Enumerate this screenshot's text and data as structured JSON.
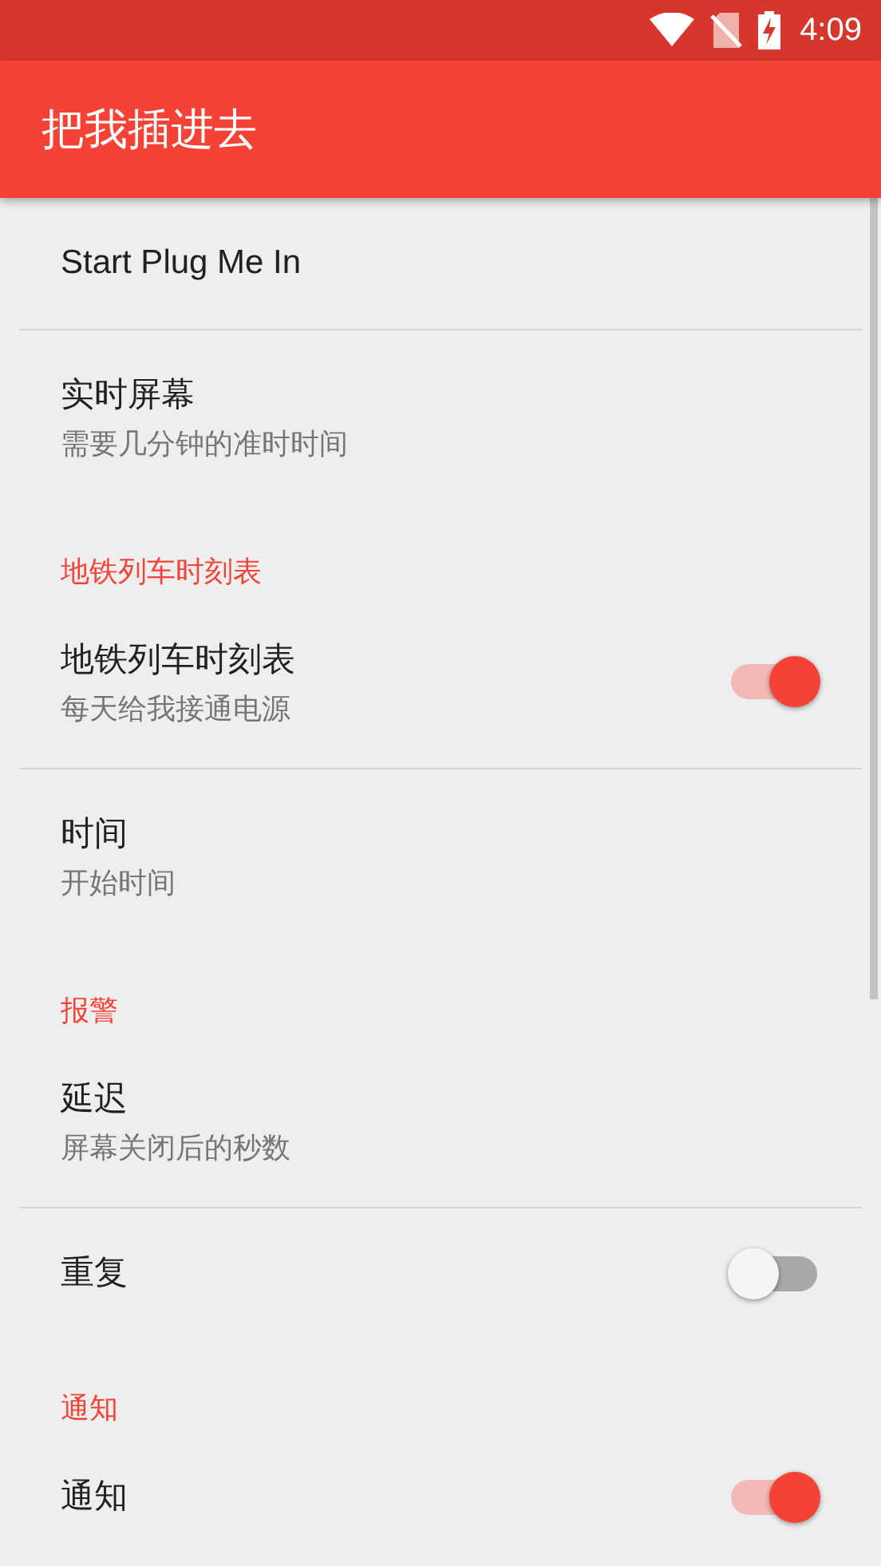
{
  "status_bar": {
    "time": "4:09"
  },
  "app_bar": {
    "title": "把我插进去"
  },
  "preferences": [
    {
      "kind": "item",
      "title": "Start Plug Me In",
      "divider": true
    },
    {
      "kind": "item",
      "title": "实时屏幕",
      "summary": "需要几分钟的准时时间",
      "divider": false
    },
    {
      "kind": "category",
      "title": "地铁列车时刻表"
    },
    {
      "kind": "switch",
      "title": "地铁列车时刻表",
      "summary": "每天给我接通电源",
      "on": true,
      "divider": true
    },
    {
      "kind": "item",
      "title": "时间",
      "summary": "开始时间",
      "divider": false
    },
    {
      "kind": "category",
      "title": "报警"
    },
    {
      "kind": "item",
      "title": "延迟",
      "summary": "屏幕关闭后的秒数",
      "divider": true
    },
    {
      "kind": "switch",
      "title": "重复",
      "on": false,
      "divider": false
    },
    {
      "kind": "category",
      "title": "通知"
    },
    {
      "kind": "switch",
      "title": "通知",
      "on": true,
      "divider": false
    }
  ]
}
